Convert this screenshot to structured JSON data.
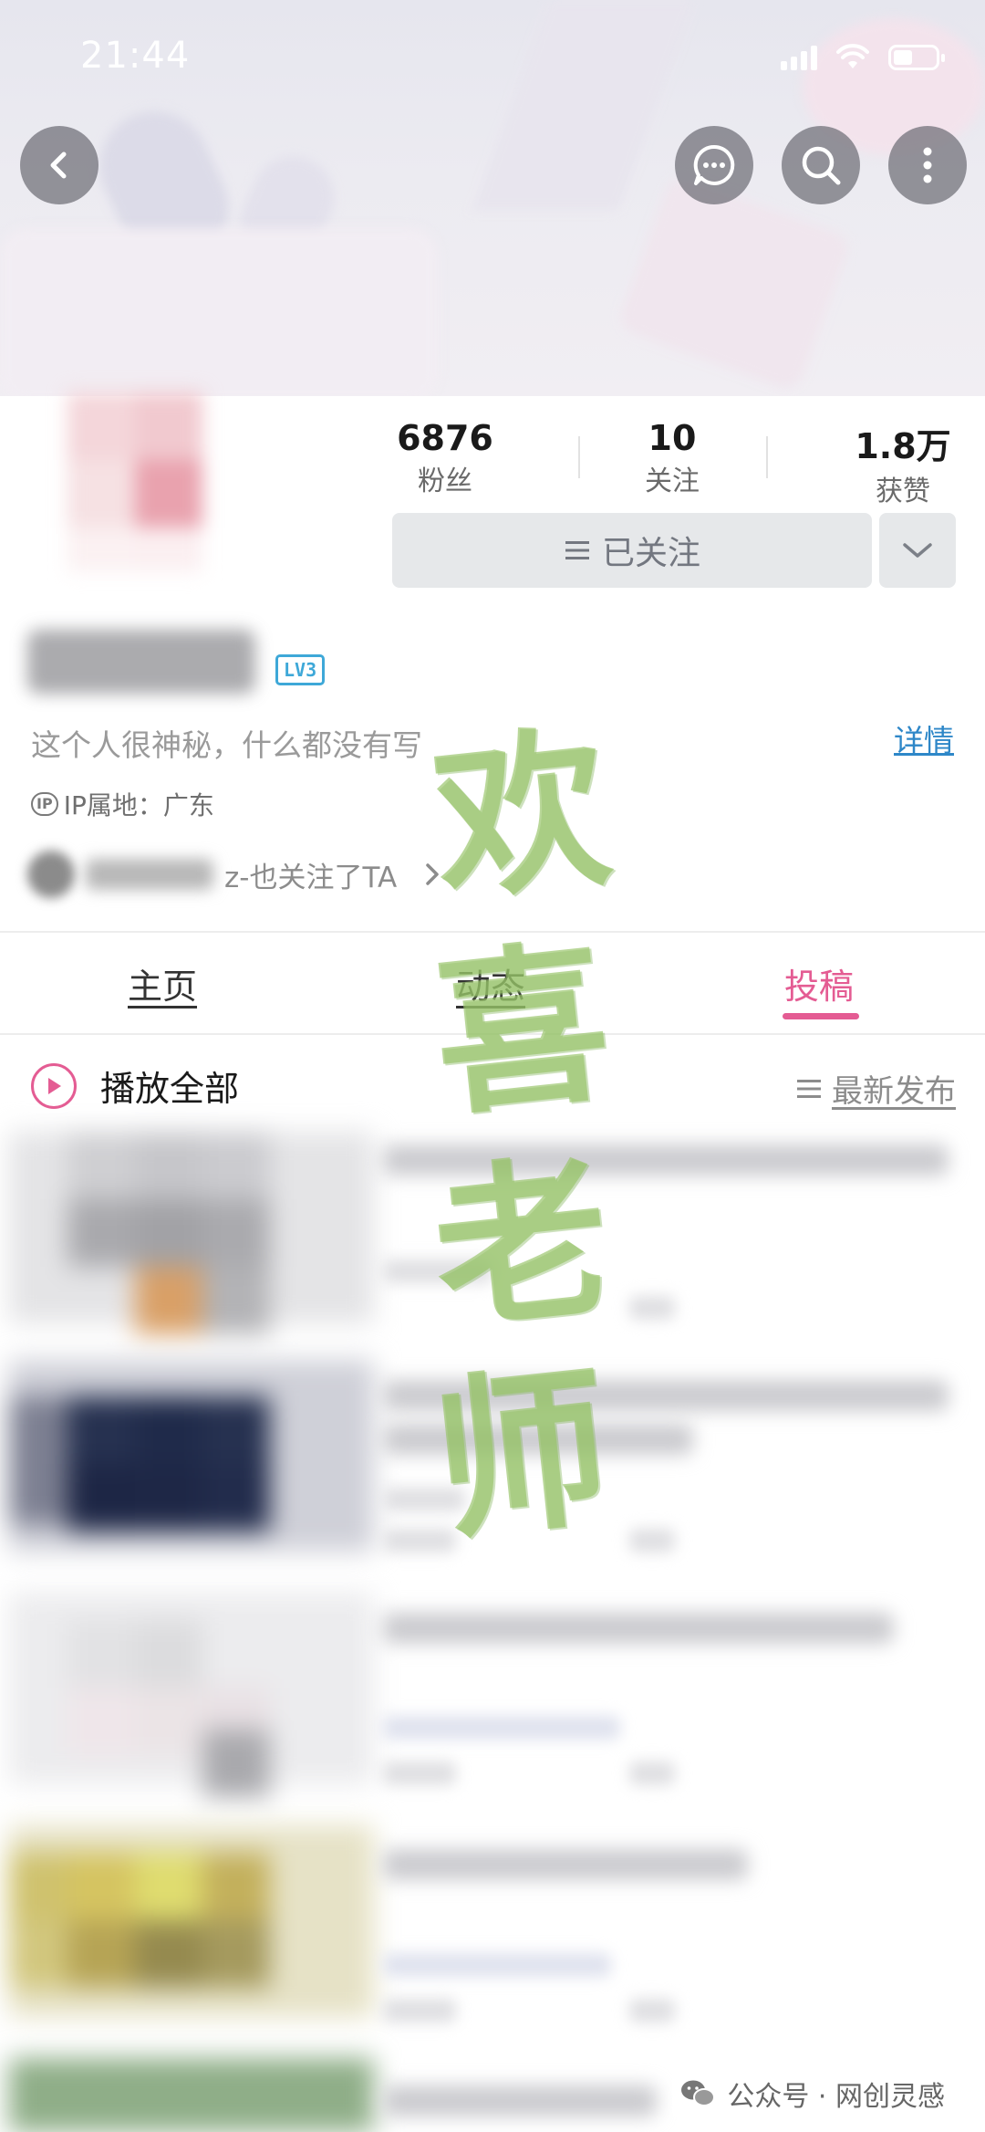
{
  "status_bar": {
    "time": "21:44"
  },
  "header": {
    "back_icon": "chevron-left-icon",
    "actions": [
      "message-icon",
      "search-icon",
      "more-icon"
    ]
  },
  "profile": {
    "stats": [
      {
        "value": "6876",
        "label": "粉丝"
      },
      {
        "value": "10",
        "label": "关注"
      },
      {
        "value": "1.8万",
        "label": "获赞"
      }
    ],
    "follow_button": "已关注",
    "level_badge": "LV3",
    "bio": "这个人很神秘，什么都没有写",
    "detail_link": "详情",
    "ip_tag": "IP",
    "ip_location": "IP属地：广东",
    "mutual_text": "z-也关注了TA"
  },
  "tabs": [
    {
      "label": "主页",
      "active": false
    },
    {
      "label": "动态",
      "active": false
    },
    {
      "label": "投稿",
      "active": true
    }
  ],
  "list_header": {
    "play_all": "播放全部",
    "sort_label": "最新发布"
  },
  "watermark": {
    "chars": [
      "欢",
      "喜",
      "老",
      "师"
    ],
    "footer": "公众号 · 网创灵感"
  },
  "colors": {
    "accent": "#e45c93",
    "link": "#2e87c8",
    "level_badge": "#3ea8d8",
    "watermark": "#98c469"
  }
}
